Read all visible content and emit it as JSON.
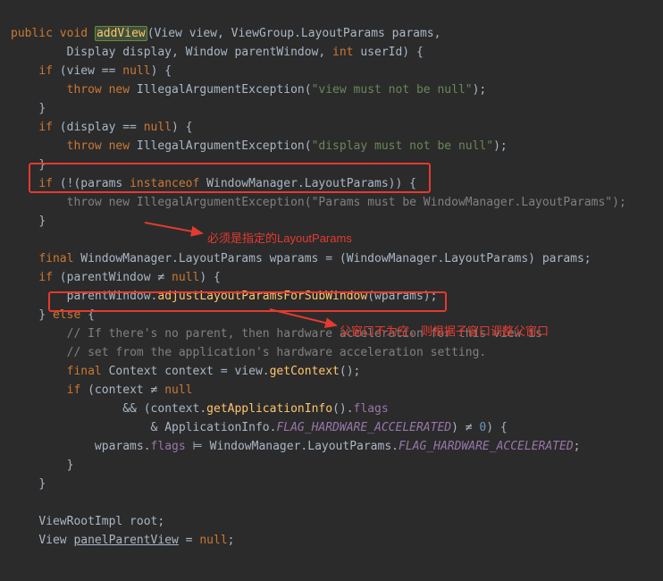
{
  "colors": {
    "annotation": "#e43a2f"
  },
  "annotations": {
    "a1": "必须是指定的LayoutParams",
    "a2": "父窗口不为空，则根据子窗口调整父窗口"
  },
  "code": {
    "l1_public": "public",
    "l1_void": "void",
    "l1_addView": "addView",
    "l1_sig_open": "(View view, ViewGroup.LayoutParams params,",
    "l2_sig": "        Display display, Window parentWindow, ",
    "l2_int": "int",
    "l2_userId": " userId) {",
    "l3_if": "if",
    "l3_cond_open": " (view == ",
    "l3_null": "null",
    "l3_cond_close": ") {",
    "l4_throw": "throw",
    "l4_new": "new",
    "l4_ex": " IllegalArgumentException(",
    "l4_str": "\"view must not be null\"",
    "l4_end": ");",
    "rbrace": "}",
    "l6_if": "if",
    "l6_cond_open": " (display == ",
    "l6_null": "null",
    "l6_cond_close": ") {",
    "l7_throw": "throw",
    "l7_new": "new",
    "l7_ex": " IllegalArgumentException(",
    "l7_str": "\"display must not be null\"",
    "l7_end": ");",
    "l9_if": "if",
    "l9_open": " (!(params ",
    "l9_instanceof": "instanceof",
    "l9_rest": " WindowManager.LayoutParams)) {",
    "l10_throw": "throw",
    "l10_new": "new",
    "l10_ex": " IllegalArgumentException(",
    "l10_str": "\"Params must be WindowManager.LayoutParams\"",
    "l10_end": ");",
    "l13_final": "final",
    "l13_rest": " WindowManager.LayoutParams wparams = (WindowManager.LayoutParams) params;",
    "l14_if": "if",
    "l14_open": " (parentWindow ≠ ",
    "l14_null": "null",
    "l14_close": ") {",
    "l15_pw": "parentWindow.",
    "l15_method": "adjustLayoutParamsForSubWindow",
    "l15_args": "(wparams);",
    "l16_else": "else",
    "l16_brace": " {",
    "l17_cmt": "// If there's no parent, then hardware acceleration for this view is",
    "l18_cmt": "// set from the application's hardware acceleration setting.",
    "l19_final": "final",
    "l19_rest_a": " Context context = view.",
    "l19_getctx": "getContext",
    "l19_rest_b": "();",
    "l20_if": "if",
    "l20_open": " (context ≠ ",
    "l20_null": "null",
    "l21_and": "&&",
    "l21_open": " (context.",
    "l21_gai": "getApplicationInfo",
    "l21_mid": "().",
    "l21_flags": "flags",
    "l22_amp": "& ApplicationInfo.",
    "l22_const": "FLAG_HARDWARE_ACCELERATED",
    "l22_close": ") ≠ ",
    "l22_zero": "0",
    "l22_end": ") {",
    "l23_wp": "wparams.",
    "l23_flags": "flags",
    "l23_assign": " ⊨ WindowManager.LayoutParams.",
    "l23_const": "FLAG_HARDWARE_ACCELERATED",
    "l23_semi": ";",
    "l27_root": "ViewRootImpl root;",
    "l28_a": "View ",
    "l28_ppv": "panelParentView",
    "l28_eq": " = ",
    "l28_null": "null",
    "l28_semi": ";"
  }
}
